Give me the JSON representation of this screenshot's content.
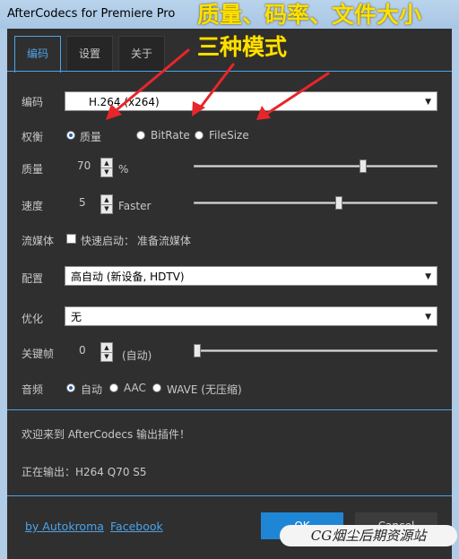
{
  "window": {
    "title": "AfterCodecs for Premiere Pro"
  },
  "annotation": {
    "line1": "质量、码率、文件大小",
    "line2": "三种模式"
  },
  "tabs": [
    {
      "label": "编码",
      "active": true
    },
    {
      "label": "设置",
      "active": false
    },
    {
      "label": "关于",
      "active": false
    }
  ],
  "encoding": {
    "label": "编码",
    "value": "H.264 (x264)"
  },
  "tradeoff": {
    "label": "权衡",
    "options": [
      {
        "label": "质量",
        "selected": true
      },
      {
        "label": "BitRate",
        "selected": false
      },
      {
        "label": "FileSize",
        "selected": false
      }
    ]
  },
  "quality": {
    "label": "质量",
    "value": "70",
    "unit": "%",
    "slider_level": 0.7
  },
  "speed": {
    "label": "速度",
    "value": "5",
    "unit": "Faster",
    "slider_level": 0.6
  },
  "streaming": {
    "label": "流媒体",
    "checkbox_label": "快速启动：",
    "note": "准备流媒体",
    "checked": false
  },
  "preset": {
    "label": "配置",
    "value": "高自动 (新设备, HDTV)"
  },
  "optimize": {
    "label": "优化",
    "value": "无"
  },
  "keyframe": {
    "label": "关键帧",
    "value": "0",
    "unit": "(自动)",
    "slider_level": 0.0
  },
  "audio": {
    "label": "音频",
    "options": [
      {
        "label": "自动",
        "selected": true
      },
      {
        "label": "AAC",
        "selected": false
      },
      {
        "label": "WAVE (无压缩)",
        "selected": false
      }
    ]
  },
  "info": {
    "welcome": "欢迎来到 AfterCodecs 输出插件！",
    "output": "正在输出：H264 Q70 S5"
  },
  "footer": {
    "link_author": "by Autokroma",
    "link_facebook": "Facebook",
    "ok_label": "OK",
    "cancel_label": "Cancel"
  },
  "watermark": {
    "text": "CG烟尘后期资源站"
  },
  "colors": {
    "accent": "#4da3e8",
    "panel": "#2f2f2f",
    "annotation": "#ffe000",
    "arrow": "#e8262a"
  }
}
